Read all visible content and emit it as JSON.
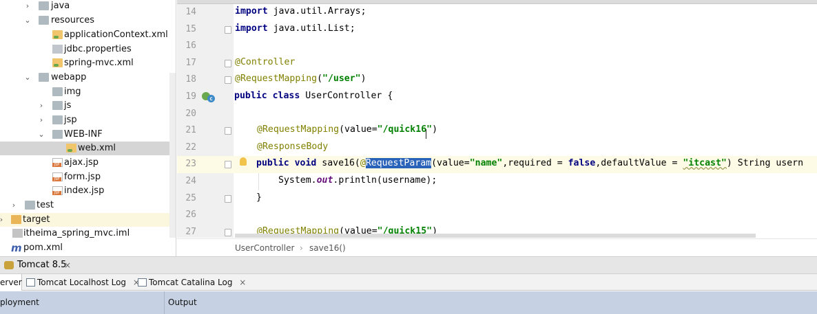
{
  "project_tree": {
    "items": [
      {
        "label": "java",
        "icon": "folder-icon",
        "expanded": false
      },
      {
        "label": "resources",
        "icon": "resources-folder-icon",
        "expanded": true
      },
      {
        "label": "applicationContext.xml",
        "icon": "xml-file-icon"
      },
      {
        "label": "jdbc.properties",
        "icon": "properties-file-icon"
      },
      {
        "label": "spring-mvc.xml",
        "icon": "xml-file-icon"
      },
      {
        "label": "webapp",
        "icon": "folder-icon",
        "expanded": true
      },
      {
        "label": "img",
        "icon": "folder-icon"
      },
      {
        "label": "js",
        "icon": "folder-icon",
        "expanded": false
      },
      {
        "label": "jsp",
        "icon": "folder-icon",
        "expanded": false
      },
      {
        "label": "WEB-INF",
        "icon": "folder-icon",
        "expanded": true
      },
      {
        "label": "web.xml",
        "icon": "xml-file-icon",
        "selected": true
      },
      {
        "label": "ajax.jsp",
        "icon": "jsp-file-icon"
      },
      {
        "label": "form.jsp",
        "icon": "jsp-file-icon"
      },
      {
        "label": "index.jsp",
        "icon": "jsp-file-icon"
      },
      {
        "label": "test",
        "icon": "folder-icon",
        "expanded": false
      },
      {
        "label": "target",
        "icon": "target-folder-icon",
        "expanded": false
      },
      {
        "label": "itheima_spring_mvc.iml",
        "icon": "iml-file-icon"
      },
      {
        "label": "pom.xml",
        "icon": "maven-m-icon"
      }
    ]
  },
  "editor": {
    "line_numbers": [
      "14",
      "15",
      "16",
      "17",
      "18",
      "19",
      "20",
      "21",
      "22",
      "23",
      "24",
      "25",
      "26",
      "27"
    ],
    "line14": {
      "kw": "import",
      "rest": " java.util.Arrays;"
    },
    "line15": {
      "kw": "import",
      "rest": " java.util.List;"
    },
    "line17": {
      "an": "@Controller"
    },
    "line18": {
      "an": "@RequestMapping",
      "p1": "(",
      "st": "\"/user\"",
      "p2": ")"
    },
    "line19": {
      "kw": "public class",
      "rest": " UserController {"
    },
    "line21": {
      "an": "@RequestMapping",
      "p1": "(value=",
      "st": "\"/quick16\"",
      "p2": ")"
    },
    "line22": {
      "an": "@ResponseBody"
    },
    "line23": {
      "kw1": "public void",
      "t1": " save16(",
      "an": "@",
      "sel": "RequestParam",
      "t2": "(value=",
      "st1": "\"name\"",
      "t3": ",required = ",
      "kw2": "false",
      "t4": ",defaultValue = ",
      "st2": "\"itcast\"",
      "t5": ") String usern"
    },
    "line24": {
      "t1": "System.",
      "fl": "out",
      "t2": ".println(username);"
    },
    "line25": {
      "t": "}"
    },
    "line27": {
      "an": "@RequestMapping",
      "p1": "(value=",
      "st": "\"/quick15\"",
      "p2": ")"
    }
  },
  "breadcrumb": {
    "class": "UserController",
    "sep": "›",
    "method": "save16()"
  },
  "run": {
    "config": "Tomcat 8.5",
    "close": "×"
  },
  "log_tabs": [
    {
      "label": "erver"
    },
    {
      "label": "Tomcat Localhost Log",
      "close": "×"
    },
    {
      "label": "Tomcat Catalina Log",
      "close": "×"
    }
  ],
  "panes": {
    "deployment": "ployment",
    "output": "Output"
  },
  "colors": {
    "selection": "#2962b9",
    "current_line": "#fdfbe6",
    "pane_header": "#c6d2e3"
  }
}
